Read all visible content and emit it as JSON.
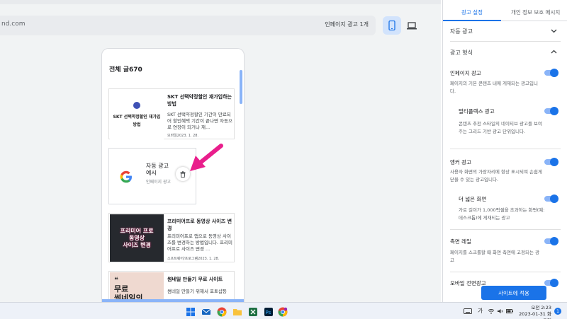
{
  "preview": {
    "url": "nd.com",
    "status": "인페이지 광고 1개",
    "device_mobile_icon": "smartphone-icon",
    "device_desktop_icon": "laptop-icon",
    "title": "전체 글670",
    "posts": [
      {
        "title": "SKT 선택약정할인 재가입하는 방법",
        "desc": "SKT 선택약정할인 기간이 만료되어 할인혜택 기간이 끝나면 자동으로 연장이 되거나 재...",
        "meta": "모바일2023. 1. 28.",
        "thumb_lines": [
          "SKT 선택약정할인 재가입",
          "방법"
        ]
      },
      {
        "title": "프리미어프로 동영상 사이즈 변경",
        "desc": "프리미어프로 앱으로 동영상 사이즈를 변경하는 방법입니다. 프리미어프로 사이즈 변경 ...",
        "meta": "소프트웨어/프로그램2023. 1. 28.",
        "thumb_lines": [
          "프리미어 프로",
          "동영상",
          "사이즈 변경"
        ]
      },
      {
        "title": "썸네일 만들기 무료 사이트",
        "desc": "썸네일 만들기 위해서 포토샵등",
        "thumb_lines": [
          "❝",
          "무료",
          "썸네일의"
        ]
      }
    ],
    "ad": {
      "title": "자동 광고 예시",
      "sub": "인페이지 광고"
    }
  },
  "panel": {
    "tabs": [
      "광고 설정",
      "개인 정보 보호 메시지"
    ],
    "auto_ads": "자동 광고",
    "ad_formats": "광고 형식",
    "options": [
      {
        "label": "인페이지 광고",
        "desc": "페이지의 기본 콘텐츠 내에 게재되는 광고입니다."
      },
      {
        "label": "멀티플렉스 광고",
        "desc": "콘텐츠 추천 스타일의 네이티브 광고를 보여 주는 그리드 기반 광고 단위입니다."
      },
      {
        "label": "앵커 광고",
        "desc": "사용자 화면의 가장자리에 항상 표시되며 손쉽게 닫을 수 있는 광고입니다."
      },
      {
        "label": "더 넓은 화면",
        "desc": "가로 길이가 1,000픽셀을 초과하는 화면(예: 데스크톱)에 게재되는 광고"
      },
      {
        "label": "측면 레일",
        "desc": "페이지를 스크롤할 때 화면 측면에 고정되는 광고"
      },
      {
        "label": "모바일 전면광고",
        "desc": ""
      }
    ],
    "apply_button": "사이트에 적용"
  },
  "taskbar": {
    "time": "오전 2:23",
    "date": "2023-01-31 화요일",
    "lang": "가",
    "notifications": "1"
  },
  "colors": {
    "accent": "#1a73e8",
    "toggle_track": "#8ab4f8",
    "highlight_arrow": "#e91e8c"
  }
}
